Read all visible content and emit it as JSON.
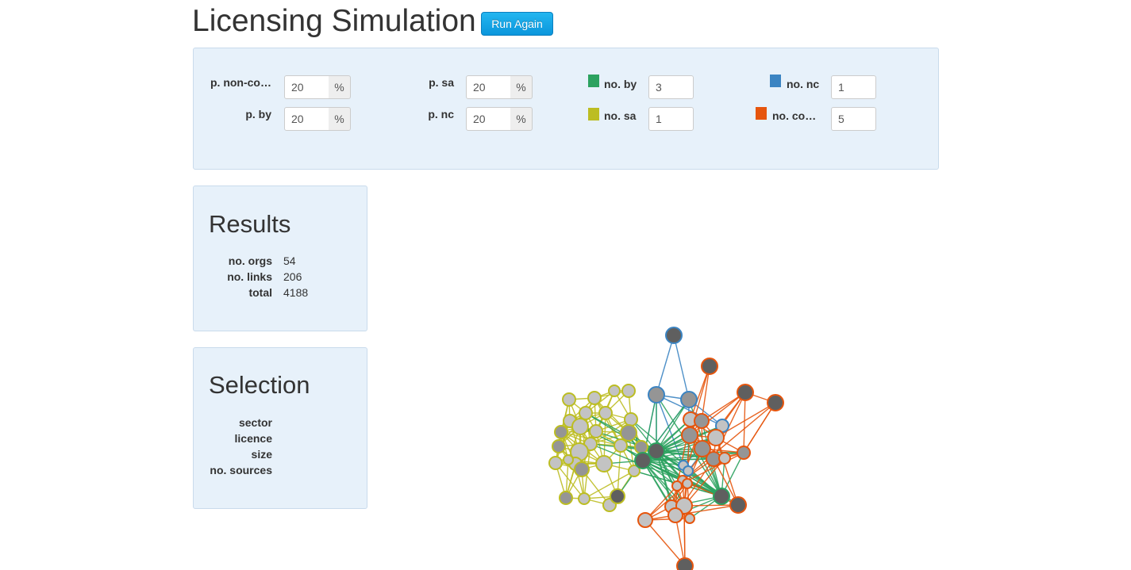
{
  "title": "Licensing Simulation",
  "run_button": "Run Again",
  "colors": {
    "by": "#2ca25f",
    "sa": "#bcbd22",
    "nc": "#3b84c2",
    "commercial": "#e6550d",
    "panel_bg": "#e7f1fa",
    "button": "#0b96dc"
  },
  "params": {
    "p_noncommercial": {
      "label": "p. non-co…",
      "value": "20",
      "unit": "%"
    },
    "p_by": {
      "label": "p. by",
      "value": "20",
      "unit": "%"
    },
    "p_sa": {
      "label": "p. sa",
      "value": "20",
      "unit": "%"
    },
    "p_nc": {
      "label": "p. nc",
      "value": "20",
      "unit": "%"
    },
    "no_by": {
      "label": "no. by",
      "value": "3"
    },
    "no_sa": {
      "label": "no. sa",
      "value": "1"
    },
    "no_nc": {
      "label": "no. nc",
      "value": "1"
    },
    "no_commercial": {
      "label": "no. co…",
      "value": "5"
    }
  },
  "results": {
    "heading": "Results",
    "rows": [
      {
        "label": "no. orgs",
        "value": "54"
      },
      {
        "label": "no. links",
        "value": "206"
      },
      {
        "label": "total",
        "value": "4188"
      }
    ]
  },
  "selection": {
    "heading": "Selection",
    "rows": [
      {
        "label": "sector",
        "value": ""
      },
      {
        "label": "licence",
        "value": ""
      },
      {
        "label": "size",
        "value": ""
      },
      {
        "label": "no. sources",
        "value": ""
      }
    ]
  }
}
